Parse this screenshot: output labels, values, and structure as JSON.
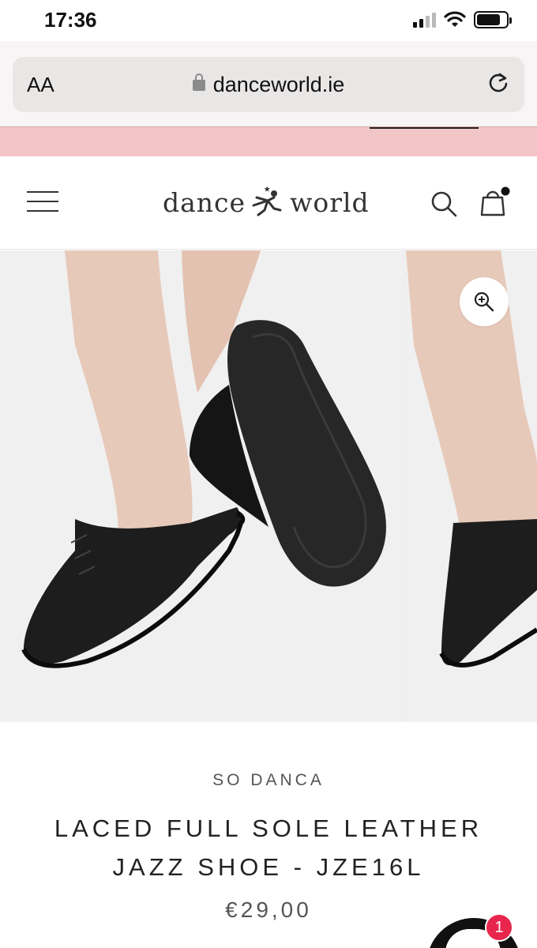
{
  "status_bar": {
    "time": "17:36",
    "battery_level": 0.8,
    "signal_bars_active": 2,
    "icons": [
      "signal-icon",
      "wifi-icon",
      "battery-icon"
    ]
  },
  "browser": {
    "text_size_label": "AA",
    "url": "danceworld.ie",
    "icons": [
      "lock-icon",
      "reload-icon"
    ]
  },
  "header": {
    "logo_left": "dance",
    "logo_right": "world",
    "icons": [
      "menu-icon",
      "search-icon",
      "cart-icon"
    ],
    "cart_has_items": true
  },
  "gallery": {
    "zoom_icon": "zoom-in-icon",
    "slides": [
      "black laced jazz shoe worn on feet, sole view",
      "black laced jazz shoe, next image"
    ]
  },
  "product": {
    "brand": "SO DANCA",
    "title": "LACED FULL SOLE LEATHER JAZZ SHOE - JZE16L",
    "price": "€29,00"
  },
  "chat": {
    "badge_count": "1"
  },
  "colors": {
    "promo_strip": "#f2c6c7",
    "badge": "#e8264d",
    "text": "#222222"
  }
}
